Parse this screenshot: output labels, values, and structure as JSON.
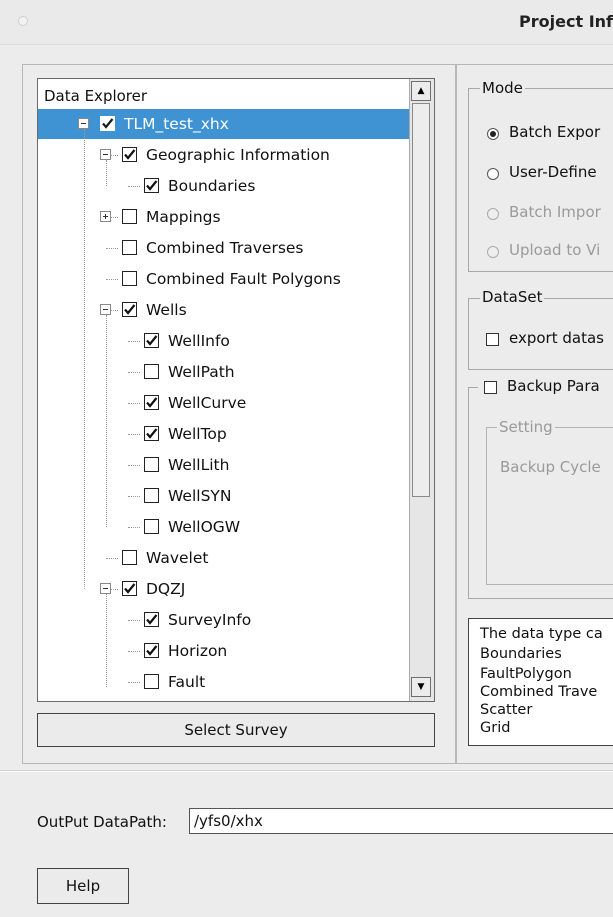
{
  "window": {
    "title": "Project Inf"
  },
  "explorer": {
    "title": "Data Explorer",
    "items": [
      {
        "label": "TLM_test_xhx",
        "checked": true,
        "selected": true
      },
      {
        "label": "Geographic Information",
        "checked": true
      },
      {
        "label": "Boundaries",
        "checked": true
      },
      {
        "label": "Mappings",
        "checked": false
      },
      {
        "label": "Combined Traverses",
        "checked": false
      },
      {
        "label": "Combined Fault Polygons",
        "checked": false
      },
      {
        "label": "Wells",
        "checked": true
      },
      {
        "label": "WellInfo",
        "checked": true
      },
      {
        "label": "WellPath",
        "checked": false
      },
      {
        "label": "WellCurve",
        "checked": true
      },
      {
        "label": "WellTop",
        "checked": true
      },
      {
        "label": "WellLith",
        "checked": false
      },
      {
        "label": "WellSYN",
        "checked": false
      },
      {
        "label": "WellOGW",
        "checked": false
      },
      {
        "label": "Wavelet",
        "checked": false
      },
      {
        "label": "DQZJ",
        "checked": true
      },
      {
        "label": "SurveyInfo",
        "checked": true
      },
      {
        "label": "Horizon",
        "checked": true
      },
      {
        "label": "Fault",
        "checked": false
      }
    ],
    "select_survey_label": "Select Survey"
  },
  "mode": {
    "title": "Mode",
    "options": [
      {
        "label": "Batch Expor",
        "selected": true,
        "enabled": true
      },
      {
        "label": "User-Define",
        "selected": false,
        "enabled": true
      },
      {
        "label": "Batch Impor",
        "selected": false,
        "enabled": false
      },
      {
        "label": "Upload to Vi",
        "selected": false,
        "enabled": false
      }
    ]
  },
  "dataset": {
    "title": "DataSet",
    "export_label": "export datas",
    "export_checked": false
  },
  "backup": {
    "title": "Backup Para",
    "checked": false,
    "setting_title": "Setting",
    "cycle_label": "Backup Cycle"
  },
  "info": {
    "lines": [
      "The data type ca",
      "Boundaries",
      "FaultPolygon",
      "Combined Trave",
      "Scatter",
      "Grid"
    ]
  },
  "output": {
    "label": "OutPut DataPath:",
    "value": "/yfs0/xhx"
  },
  "help_label": "Help",
  "colors": {
    "selection": "#3f93d2",
    "window_bg": "#ececec"
  }
}
